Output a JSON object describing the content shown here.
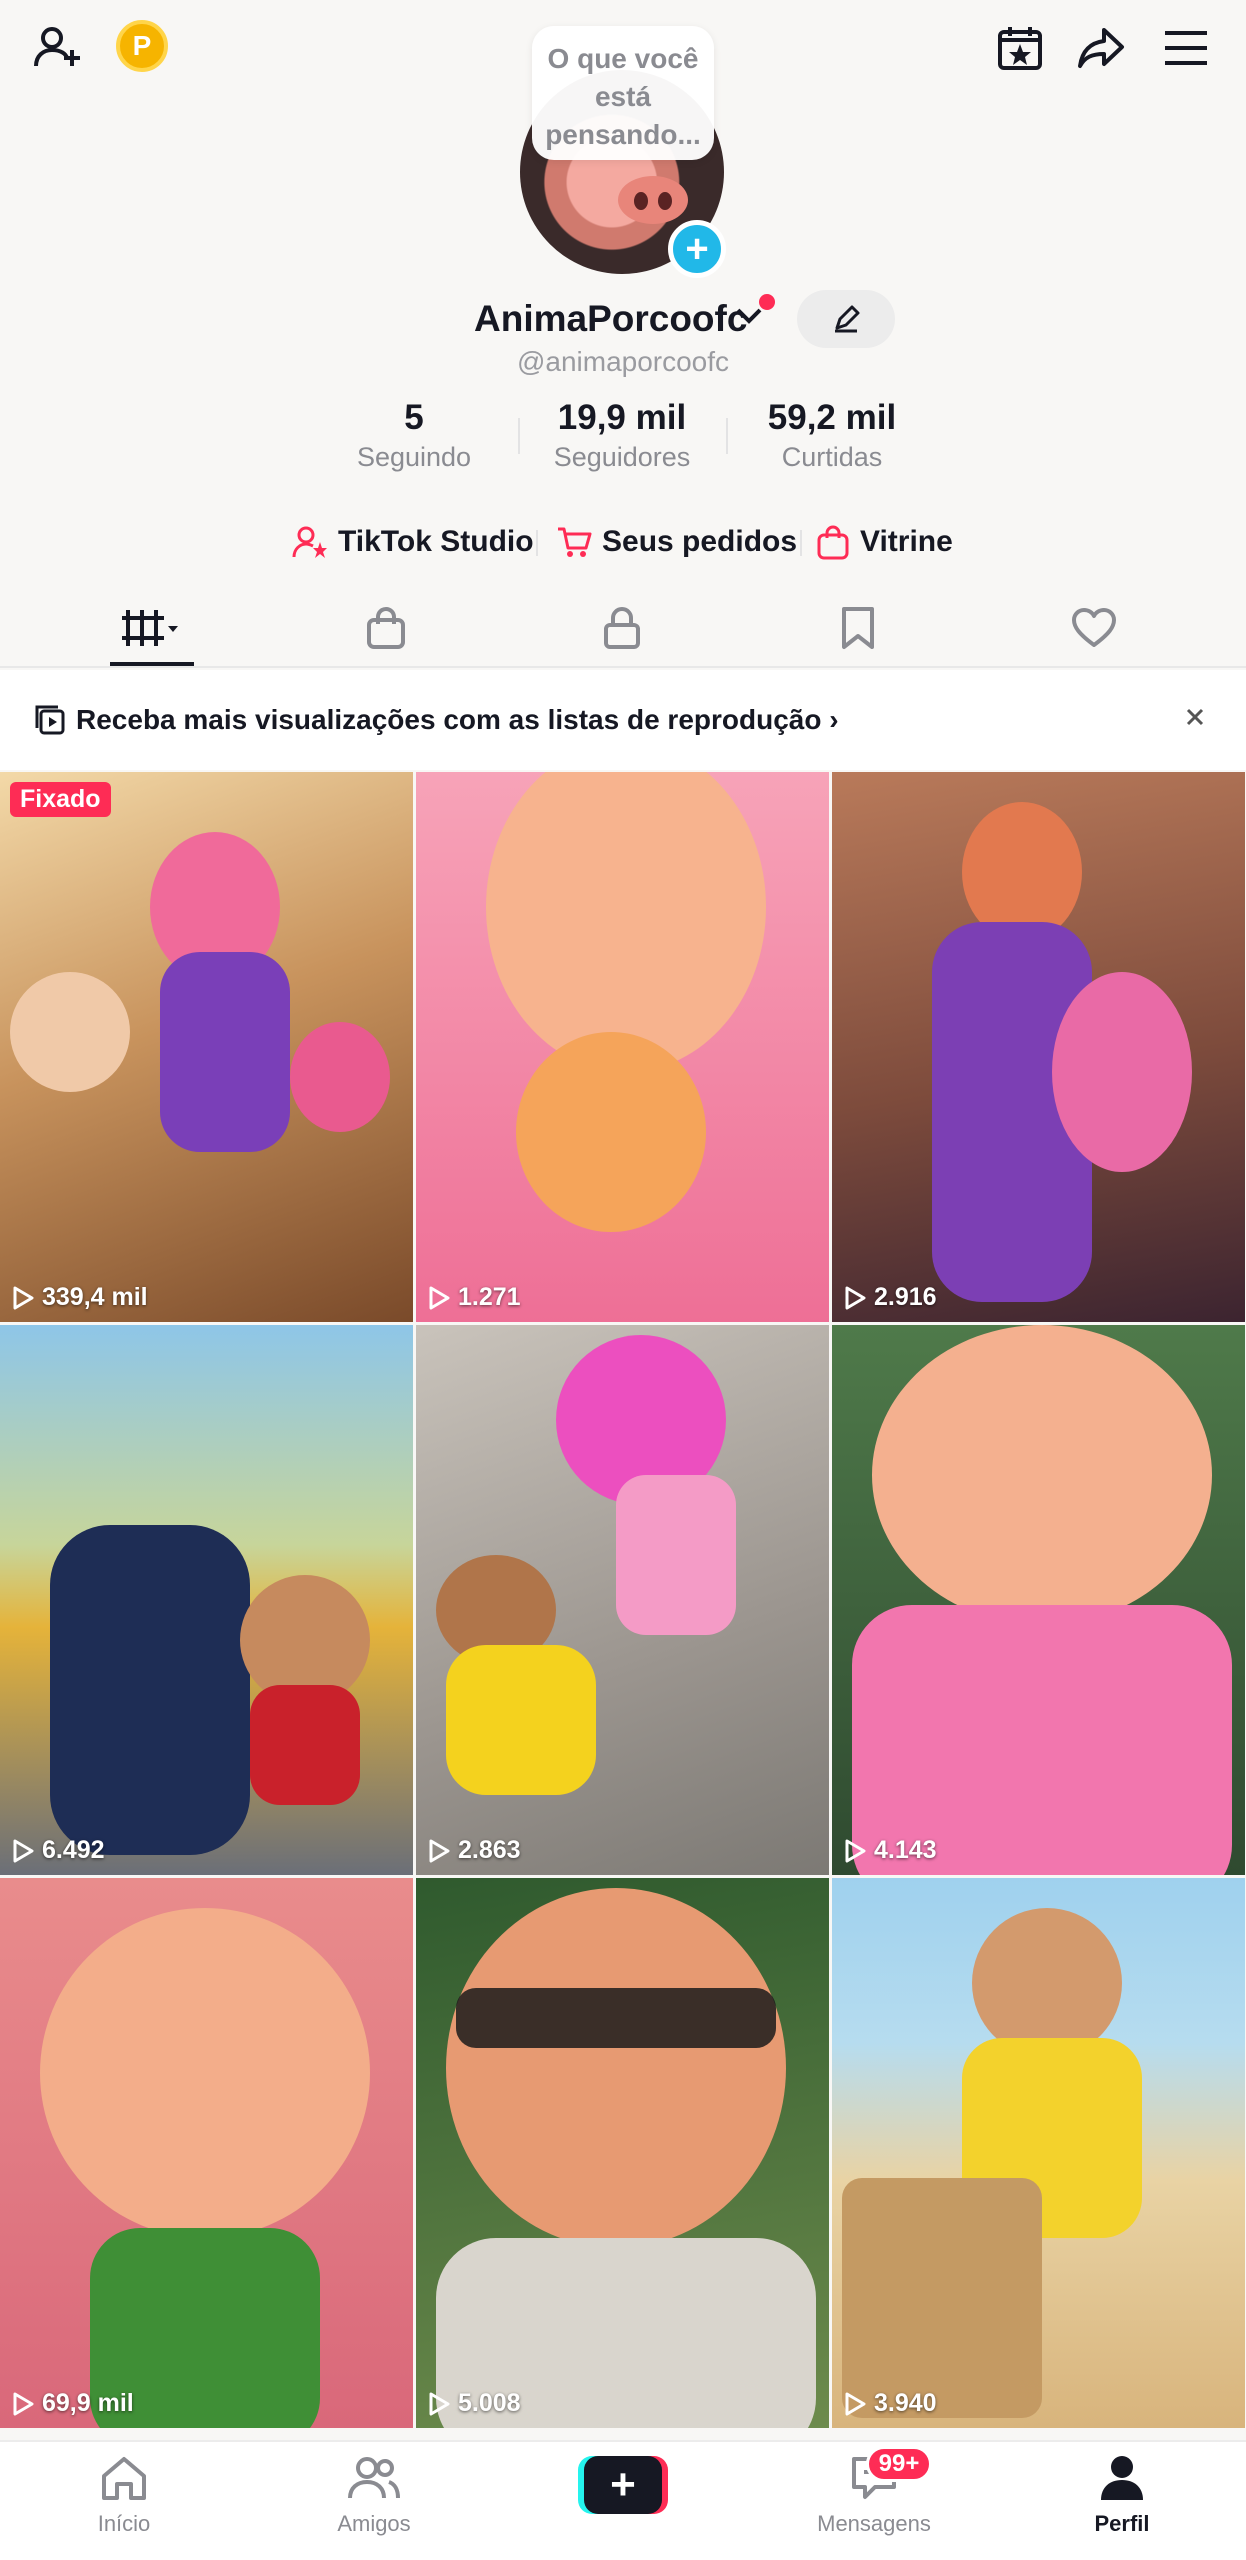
{
  "profile": {
    "thought_bubble": "O que você está pensando...",
    "username": "AnimaPorcoofc",
    "handle": "@animaporcoofc",
    "coin_label": "P"
  },
  "stats": [
    {
      "value": "5",
      "label": "Seguindo"
    },
    {
      "value": "19,9 mil",
      "label": "Seguidores"
    },
    {
      "value": "59,2 mil",
      "label": "Curtidas"
    }
  ],
  "links": {
    "studio": "TikTok Studio",
    "orders": "Seus pedidos",
    "showcase": "Vitrine"
  },
  "banner": {
    "text": "Receba mais visualizações com as listas de reprodução ›"
  },
  "videos": [
    {
      "views": "339,4 mil",
      "pinned": "Fixado"
    },
    {
      "views": "1.271"
    },
    {
      "views": "2.916"
    },
    {
      "views": "6.492"
    },
    {
      "views": "2.863"
    },
    {
      "views": "4.143"
    },
    {
      "views": "69,9 mil"
    },
    {
      "views": "5.008"
    },
    {
      "views": "3.940"
    }
  ],
  "nav": {
    "home": "Início",
    "friends": "Amigos",
    "messages": "Mensagens",
    "messages_badge": "99+",
    "profile": "Perfil"
  },
  "colors": {
    "accent": "#fe2c55",
    "cyan": "#25f4ee",
    "add_badge": "#21b8e8"
  }
}
